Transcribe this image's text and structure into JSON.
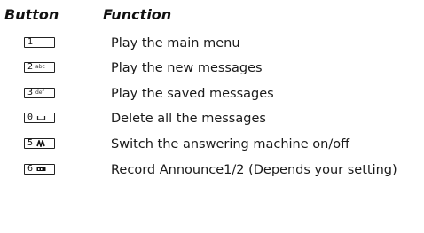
{
  "header": {
    "button": "Button",
    "function": "Function"
  },
  "rows": [
    {
      "key": {
        "digit": "1",
        "sub": "",
        "icon": ""
      },
      "function": "Play the main menu"
    },
    {
      "key": {
        "digit": "2",
        "sub": "abc",
        "icon": ""
      },
      "function": "Play the new messages"
    },
    {
      "key": {
        "digit": "3",
        "sub": "def",
        "icon": ""
      },
      "function": "Play the saved messages"
    },
    {
      "key": {
        "digit": "0",
        "sub": "",
        "icon": "space-icon"
      },
      "function": "Delete all the messages"
    },
    {
      "key": {
        "digit": "5",
        "sub": "",
        "icon": "answering-machine-icon"
      },
      "function": "Switch the answering machine on/off"
    },
    {
      "key": {
        "digit": "6",
        "sub": "",
        "icon": "record-icon"
      },
      "function": "Record Announce1/2 (Depends your setting)"
    }
  ]
}
